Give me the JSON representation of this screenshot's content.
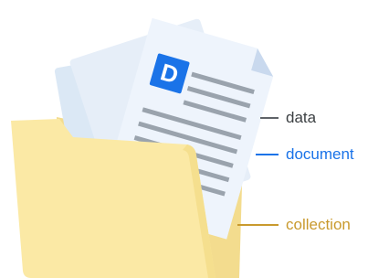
{
  "doc_icon_letter": "D",
  "labels": {
    "data": "data",
    "document": "document",
    "collection": "collection"
  },
  "colors": {
    "data": "#5f6368",
    "document": "#1a73e8",
    "collection": "#c99a2e",
    "doc_icon": "#1a73e8",
    "folder": "#fbe9a5"
  }
}
